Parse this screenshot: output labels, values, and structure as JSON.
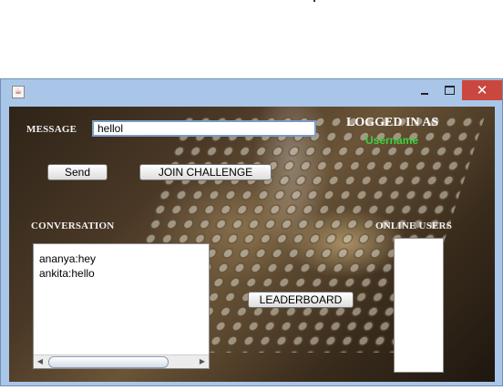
{
  "window": {
    "minimize_glyph": "—",
    "close_glyph": "✕"
  },
  "form": {
    "message_label": "MESSAGE",
    "message_value": "hellol",
    "send_label": "Send",
    "join_challenge_label": "JOIN CHALLENGE",
    "leaderboard_label": "LEADERBOARD"
  },
  "status": {
    "logged_in_label": "LOGGED IN AS",
    "username": "Username"
  },
  "conversation": {
    "label": "CONVERSATION",
    "messages": [
      "ananya:hey",
      "ankita:hello"
    ]
  },
  "online_users": {
    "label": "ONLINE USERS"
  },
  "icons": {
    "app": "java-cup-icon",
    "scroll_left": "arrow-left-icon",
    "scroll_right": "arrow-right-icon"
  },
  "colors": {
    "titlebar": "#a9c6e8",
    "close_button": "#c9473e",
    "username": "#3ed23e"
  }
}
